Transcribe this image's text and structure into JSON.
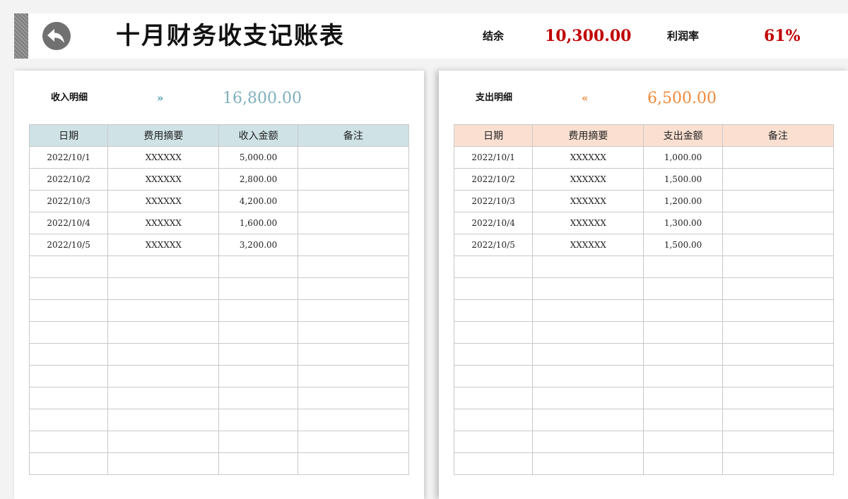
{
  "header": {
    "title": "十月财务收支记账表",
    "balance_label": "结余",
    "balance_value": "10,300.00",
    "profit_rate_label": "利润率",
    "profit_rate_value": "61%",
    "value_color": "#c00000"
  },
  "income": {
    "section_label": "收入明细",
    "arrow": "»",
    "total": "16,800.00",
    "accent_color": "#7fb0bd",
    "header_bg": "#cfe2e6",
    "columns": [
      "日期",
      "费用摘要",
      "收入金额",
      "备注"
    ],
    "rows": [
      [
        "2022/10/1",
        "XXXXXX",
        "5,000.00",
        ""
      ],
      [
        "2022/10/2",
        "XXXXXX",
        "2,800.00",
        ""
      ],
      [
        "2022/10/3",
        "XXXXXX",
        "4,200.00",
        ""
      ],
      [
        "2022/10/4",
        "XXXXXX",
        "1,600.00",
        ""
      ],
      [
        "2022/10/5",
        "XXXXXX",
        "3,200.00",
        ""
      ],
      [
        "",
        "",
        "",
        ""
      ],
      [
        "",
        "",
        "",
        ""
      ],
      [
        "",
        "",
        "",
        ""
      ],
      [
        "",
        "",
        "",
        ""
      ],
      [
        "",
        "",
        "",
        ""
      ],
      [
        "",
        "",
        "",
        ""
      ],
      [
        "",
        "",
        "",
        ""
      ],
      [
        "",
        "",
        "",
        ""
      ],
      [
        "",
        "",
        "",
        ""
      ],
      [
        "",
        "",
        "",
        ""
      ]
    ]
  },
  "expense": {
    "section_label": "支出明细",
    "arrow": "«",
    "total": "6,500.00",
    "accent_color": "#ef8a3c",
    "header_bg": "#fbe0d2",
    "columns": [
      "日期",
      "费用摘要",
      "支出金额",
      "备注"
    ],
    "rows": [
      [
        "2022/10/1",
        "XXXXXX",
        "1,000.00",
        ""
      ],
      [
        "2022/10/2",
        "XXXXXX",
        "1,500.00",
        ""
      ],
      [
        "2022/10/3",
        "XXXXXX",
        "1,200.00",
        ""
      ],
      [
        "2022/10/4",
        "XXXXXX",
        "1,300.00",
        ""
      ],
      [
        "2022/10/5",
        "XXXXXX",
        "1,500.00",
        ""
      ],
      [
        "",
        "",
        "",
        ""
      ],
      [
        "",
        "",
        "",
        ""
      ],
      [
        "",
        "",
        "",
        ""
      ],
      [
        "",
        "",
        "",
        ""
      ],
      [
        "",
        "",
        "",
        ""
      ],
      [
        "",
        "",
        "",
        ""
      ],
      [
        "",
        "",
        "",
        ""
      ],
      [
        "",
        "",
        "",
        ""
      ],
      [
        "",
        "",
        "",
        ""
      ],
      [
        "",
        "",
        "",
        ""
      ]
    ]
  }
}
